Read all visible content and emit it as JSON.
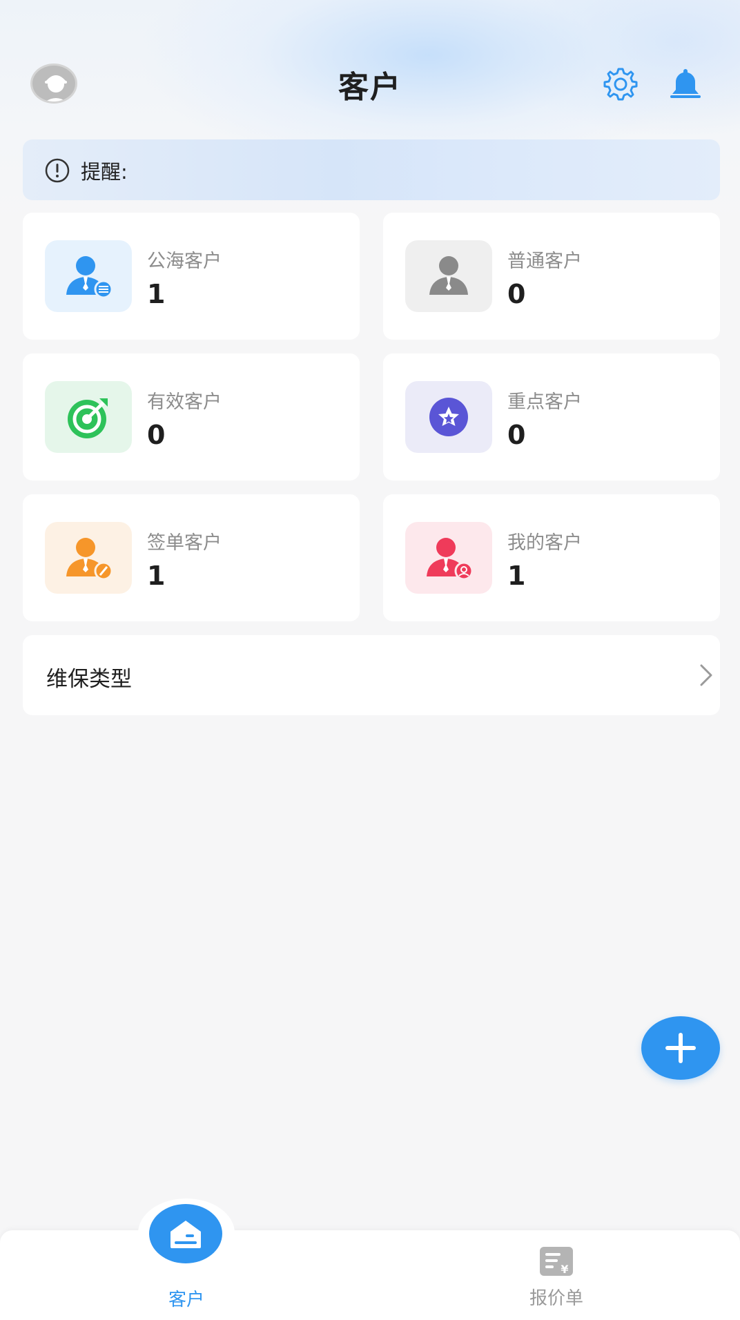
{
  "header": {
    "title": "客户",
    "icons": [
      "avatar",
      "gear-icon",
      "bell-icon"
    ]
  },
  "reminder": {
    "label": "提醒:"
  },
  "cards": [
    {
      "name": "公海客户",
      "count": "1",
      "icon": "public-customer-icon",
      "color": "#2f95f0",
      "bg": "#e6f2fd"
    },
    {
      "name": "普通客户",
      "count": "0",
      "icon": "normal-customer-icon",
      "color": "#8a8a8a",
      "bg": "#efefef"
    },
    {
      "name": "有效客户",
      "count": "0",
      "icon": "target-icon",
      "color": "#2ec25a",
      "bg": "#e5f6ea"
    },
    {
      "name": "重点客户",
      "count": "0",
      "icon": "star-badge-icon",
      "color": "#5a55d6",
      "bg": "#ebebf8"
    },
    {
      "name": "签单客户",
      "count": "1",
      "icon": "signed-customer-icon",
      "color": "#f6962a",
      "bg": "#fdf1e4"
    },
    {
      "name": "我的客户",
      "count": "1",
      "icon": "my-customer-icon",
      "color": "#ef3b5a",
      "bg": "#fde8ec"
    }
  ],
  "maintenance": {
    "label": "维保类型"
  },
  "tabbar": {
    "tabs": [
      {
        "label": "客户",
        "active": true
      },
      {
        "label": "报价单",
        "active": false
      }
    ]
  },
  "colors": {
    "accent": "#2f95f0",
    "background": "#f6f6f7"
  }
}
